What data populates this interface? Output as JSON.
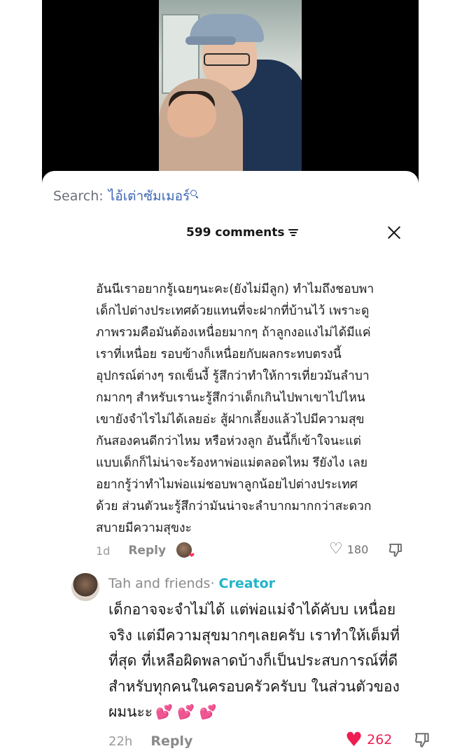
{
  "search": {
    "label": "Search:",
    "query": "ไอ้เต่าซัมเมอร์"
  },
  "header": {
    "comments_count": "599 comments"
  },
  "comment": {
    "lines": [
      "อันนีเราอยากรู้เฉยๆนะคะ(ยังไม่มีลูก) ทำไมถึงชอบพา",
      "เด็กไปต่างประเทศด้วยแทนที่จะฝากที่บ้านไว้ เพราะดู",
      "ภาพรวมคือมันต้องเหนื่อยมากๆ ถ้าลูกงอแงไม่ได้มีแค่",
      "เราที่เหนื่อย รอบข้างก็เหนื่อยกับผลกระทบตรงนี้",
      "อุปกรณ์ต่างๆ รถเข็นงี้ รู้สึกว่าทำให้การเที่ยวมันลำบา",
      "กมากๆ สำหรับเรานะรู้สึกว่าเด็กเกินไปพาเขาไปไหน",
      "เขายังจำไรไม่ได้เลยอ่ะ สู้ฝากเลี้ยงแล้วไปมีความสุข",
      "กันสองคนดีกว่าไหม หรือห่วงลูก อันนี้ก็เข้าใจนะแต่",
      "แบบเด็กก็ไม่น่าจะร้องหาพ่อแม่ตลอดไหม รึยังไง เลย",
      "อยากรู้ว่าทำไมพ่อแม่ชอบพาลูกน้อยไปต่างประเทศ",
      "ด้วย ส่วนตัวนะรู้สึกว่ามันน่าจะลำบากมากกว่าสะดวก",
      "สบายมีความสุขงะ"
    ],
    "time": "1d",
    "reply_label": "Reply",
    "likes": "180"
  },
  "creator_reply": {
    "author": "Tah and friends",
    "separator": " · ",
    "badge": "Creator",
    "lines": [
      "เด็กอาจจะจำไม่ได้ แต่พ่อแม่จำได้คับบ เหนื่อย",
      "จริง แต่มีความสุขมากๆเลยครับ เราทำให้เต็มที่",
      "ที่สุด ที่เหลือผิดพลาดบ้างก็เป็นประสบการณ์ที่ดี",
      "สำหรับทุกคนในครอบครัวครับบ ในส่วนตัวของ",
      "ผมนะะ"
    ],
    "emojis": "💕 💕 💕",
    "time": "22h",
    "reply_label": "Reply",
    "likes": "262"
  },
  "colors": {
    "creator_badge": "#21b4c9",
    "like_red": "#ee1d52",
    "search_query": "#3c66b3"
  }
}
